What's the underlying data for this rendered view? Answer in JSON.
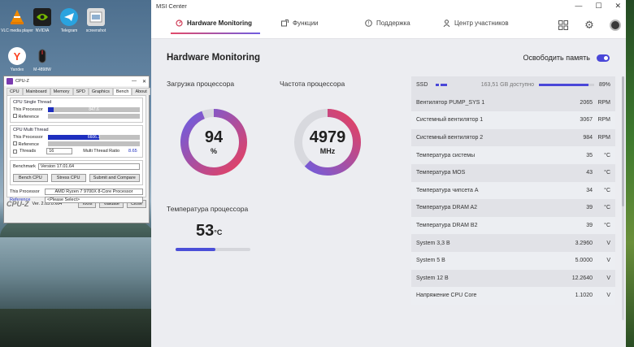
{
  "desktop": {
    "icons": [
      {
        "label": "VLC media player",
        "icon": "vlc-icon",
        "color": "#f08a00"
      },
      {
        "label": "NVIDIA",
        "icon": "nvidia-icon",
        "color": "#2a2a2a"
      },
      {
        "label": "Telegram",
        "icon": "telegram-icon",
        "color": "#2aa3df"
      },
      {
        "label": "screenshot",
        "icon": "screenshot-icon",
        "color": "#e6e6e6"
      },
      {
        "label": "Yandex",
        "icon": "yandex-icon",
        "color": "#ffffff"
      },
      {
        "label": "M-4898W",
        "icon": "mouse-icon",
        "color": "#ffffff"
      }
    ]
  },
  "cpuz": {
    "title": "CPU-Z",
    "tabs": [
      "CPU",
      "Mainboard",
      "Memory",
      "SPD",
      "Graphics",
      "Bench",
      "About"
    ],
    "active_tab": "Bench",
    "single_thread": {
      "title": "CPU Single Thread",
      "this_label": "This Processor",
      "this_value": "847.6",
      "this_fraction": 0.06,
      "ref_label": "Reference"
    },
    "multi_thread": {
      "title": "CPU Multi Thread",
      "this_label": "This Processor",
      "this_value": "6606.3",
      "this_fraction": 0.56,
      "ref_label": "Reference",
      "threads_label": "Threads",
      "threads_value": "16",
      "ratio_label": "Multi Thread Ratio",
      "ratio_value": "8.65"
    },
    "benchmark_label": "Benchmark",
    "benchmark_version": "Version 17.01.64",
    "buttons": {
      "bench": "Bench CPU",
      "stress": "Stress CPU",
      "submit": "Submit and Compare"
    },
    "this_processor_label": "This Processor",
    "this_processor_value": "AMD Ryzen 7 9700X 8-Core Processor",
    "reference_label": "Reference",
    "reference_value": "<Please Select>",
    "footer": {
      "brand": "CPU-Z",
      "version": "Ver. 2.03.0.x64",
      "tools": "Tools",
      "validate": "Validate",
      "close": "Close"
    }
  },
  "msi": {
    "window_title": "MSI Center",
    "nav": {
      "tabs": [
        {
          "label": "Hardware Monitoring",
          "icon": "monitor-icon"
        },
        {
          "label": "Функции",
          "icon": "features-icon"
        },
        {
          "label": "Поддержка",
          "icon": "support-icon"
        },
        {
          "label": "Центр участников",
          "icon": "member-icon"
        }
      ]
    },
    "page_title": "Hardware Monitoring",
    "free_memory_label": "Освободить память",
    "cpu_load": {
      "label": "Загрузка процессора",
      "value": "94",
      "unit": "%",
      "fraction": 0.94
    },
    "cpu_freq": {
      "label": "Частота процессора",
      "value": "4979",
      "unit": "MHz",
      "fraction": 0.62
    },
    "cpu_temp": {
      "label": "Температура процессора",
      "value": "53",
      "unit": "°C",
      "fraction": 0.53
    },
    "ssd": {
      "label": "SSD",
      "free": "163,51 GB доступно",
      "percent": "89%",
      "fraction": 0.89
    },
    "sensors": [
      {
        "name": "Вентилятор PUMP_SYS 1",
        "value": "2065",
        "unit": "RPM"
      },
      {
        "name": "Системный вентилятор 1",
        "value": "3067",
        "unit": "RPM"
      },
      {
        "name": "Системный вентилятор 2",
        "value": "984",
        "unit": "RPM"
      },
      {
        "name": "Температура системы",
        "value": "35",
        "unit": "°C"
      },
      {
        "name": "Температура MOS",
        "value": "43",
        "unit": "°C"
      },
      {
        "name": "Температура чипсета A",
        "value": "34",
        "unit": "°C"
      },
      {
        "name": "Температура DRAM A2",
        "value": "39",
        "unit": "°C"
      },
      {
        "name": "Температура DRAM B2",
        "value": "39",
        "unit": "°C"
      },
      {
        "name": "System 3,3 В",
        "value": "3.2960",
        "unit": "V"
      },
      {
        "name": "System 5 В",
        "value": "5.0000",
        "unit": "V"
      },
      {
        "name": "System 12 В",
        "value": "12.2640",
        "unit": "V"
      },
      {
        "name": "Напряжение CPU Core",
        "value": "1.1020",
        "unit": "V"
      }
    ],
    "colors": {
      "accent": "#4a47d8",
      "gradient_start": "#e24a6a",
      "gradient_end": "#6f5ce0"
    }
  }
}
